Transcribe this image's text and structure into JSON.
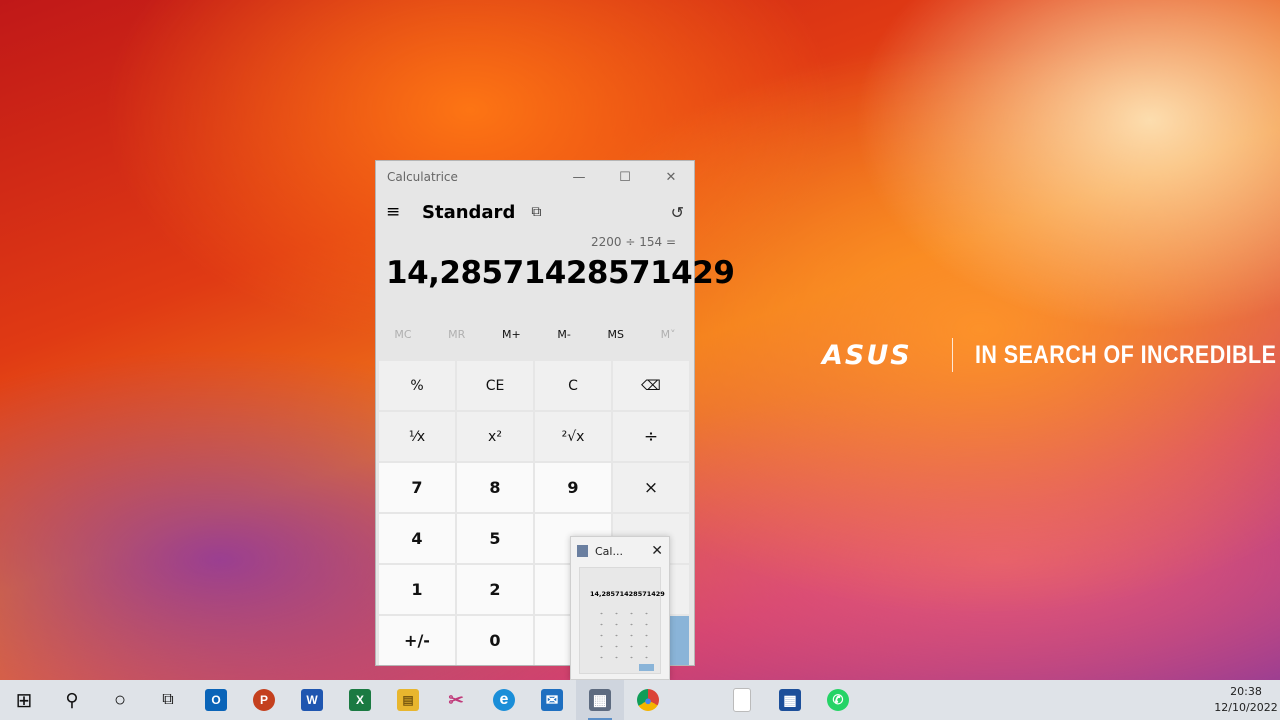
{
  "desktop": {
    "brand_logo": "ASUS",
    "tagline": "IN SEARCH OF INCREDIBLE"
  },
  "calculator": {
    "window_title": "Calculatrice",
    "minimize_glyph": "—",
    "maximize_glyph": "☐",
    "close_glyph": "✕",
    "menu_glyph": "≡",
    "mode": "Standard",
    "keep_on_top_glyph": "⧉",
    "history_glyph": "↺",
    "expression": "2200 ÷ 154 =",
    "result": "14,28571428571429",
    "memory": {
      "mc": "MC",
      "mr": "MR",
      "mplus": "M+",
      "mminus": "M-",
      "ms": "MS",
      "mlist": "M˅"
    },
    "keys": {
      "percent": "%",
      "ce": "CE",
      "c": "C",
      "backspace": "⌫",
      "reciprocal": "¹⁄x",
      "square": "x²",
      "sqrt": "²√x",
      "divide": "÷",
      "seven": "7",
      "eight": "8",
      "nine": "9",
      "multiply": "×",
      "four": "4",
      "five": "5",
      "one": "1",
      "two": "2",
      "negate": "+/-",
      "zero": "0"
    },
    "accent_color": "#8ab4d8"
  },
  "thumbnail": {
    "title": "Cal...",
    "close_glyph": "✕",
    "result": "14,28571428571429"
  },
  "taskbar": {
    "clock_time": "20:38",
    "clock_date": "12/10/2022",
    "icons": {
      "start": "⊞",
      "search": "⚲",
      "cortana": "○",
      "taskview": "⧉",
      "outlook": "O",
      "powerpoint": "P",
      "word": "W",
      "excel": "X",
      "explorer": "▤",
      "snip": "✂",
      "edge": "e",
      "mail": "✉",
      "calculator": "▦",
      "chrome": "●",
      "notepad": "▯",
      "store": "▦",
      "whatsapp": "✆"
    }
  }
}
